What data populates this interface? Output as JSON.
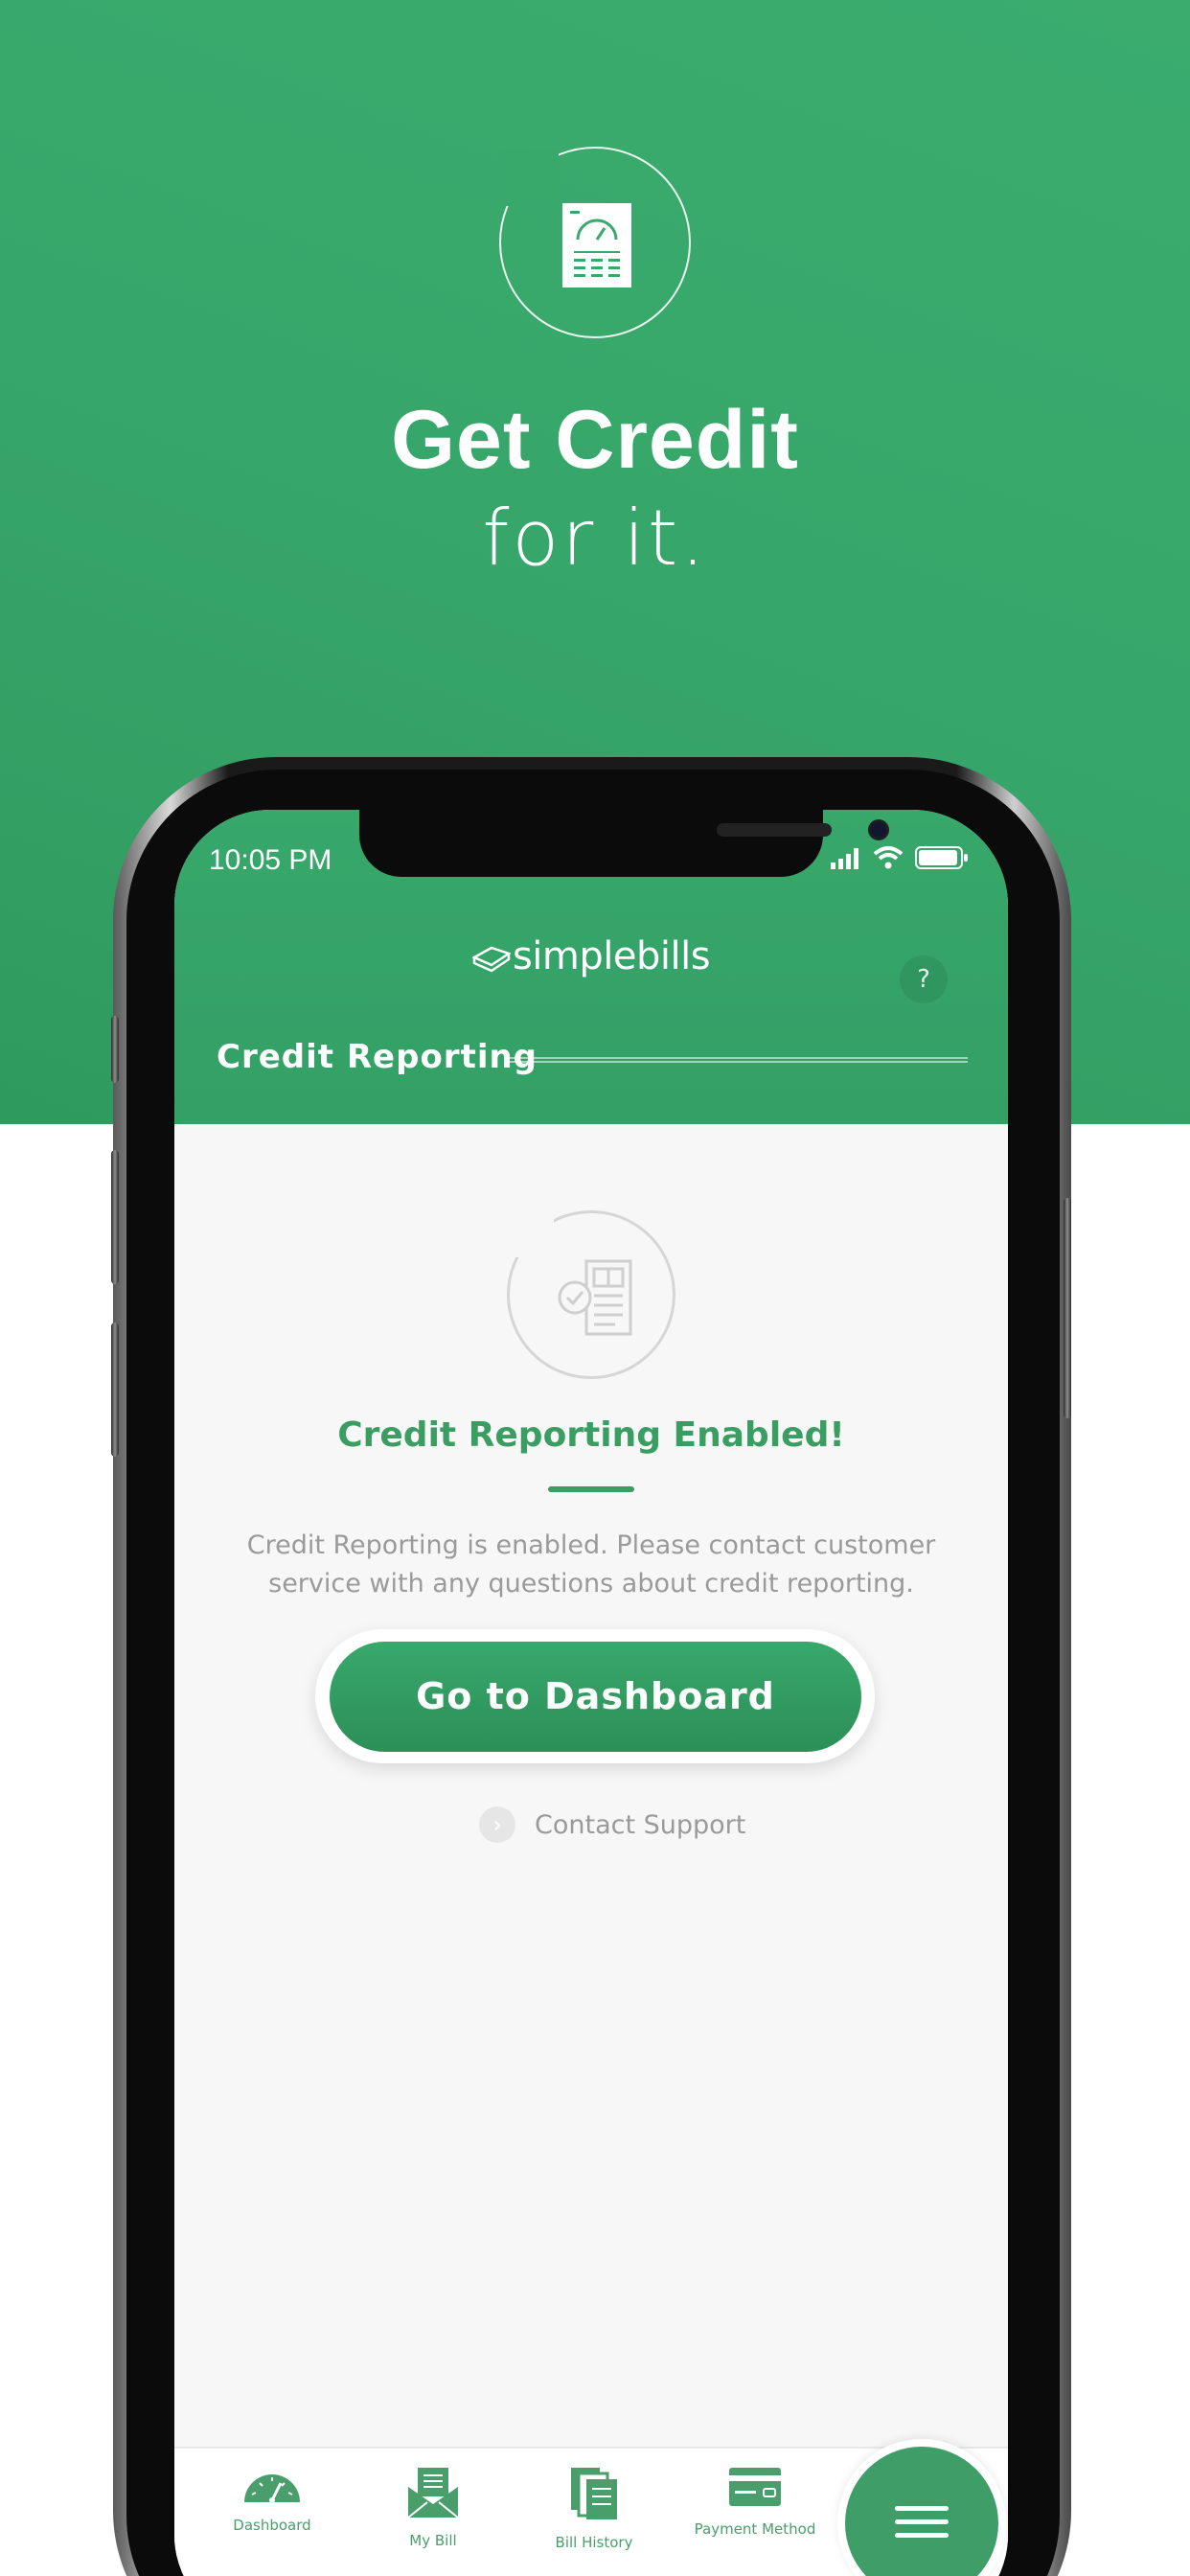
{
  "hero": {
    "title": "Get Credit",
    "subtitle": "for it.",
    "badge_icon": "credit-report-gauge-icon"
  },
  "colors": {
    "brand_green": "#37a76a",
    "accent_green": "#3a9e63",
    "muted_text": "#9a9a9a"
  },
  "status_bar": {
    "time": "10:05 PM",
    "icons": [
      "signal-icon",
      "wifi-icon",
      "battery-icon"
    ]
  },
  "app": {
    "logo_text": "simplebills",
    "help_label": "?",
    "section_title": "Credit Reporting"
  },
  "main": {
    "status_icon": "credit-report-check-icon",
    "enabled_title": "Credit Reporting Enabled!",
    "description": "Credit Reporting is enabled. Please contact customer service with any questions about credit reporting.",
    "primary_button": "Go to Dashboard",
    "secondary_link": "Contact Support"
  },
  "tabbar": {
    "items": [
      {
        "label": "Dashboard",
        "icon": "speedometer-icon"
      },
      {
        "label": "My Bill",
        "icon": "envelope-bill-icon"
      },
      {
        "label": "Bill History",
        "icon": "bill-stack-icon"
      },
      {
        "label": "Payment Method",
        "icon": "credit-card-icon"
      }
    ],
    "menu_icon": "hamburger-menu-icon"
  }
}
